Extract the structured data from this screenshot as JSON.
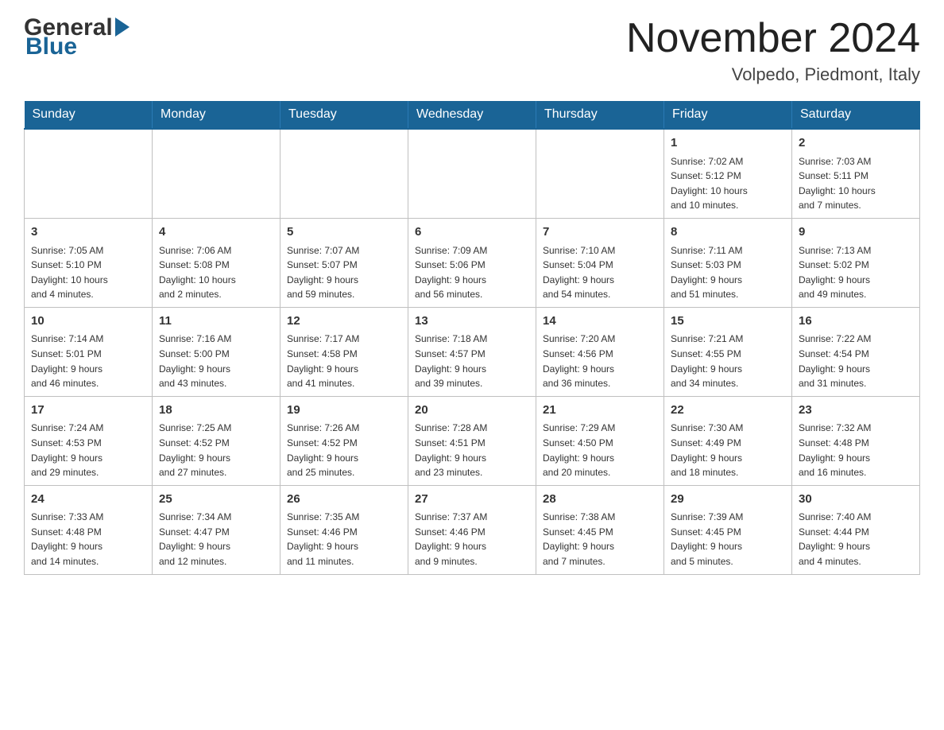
{
  "header": {
    "logo_general": "General",
    "logo_blue": "Blue",
    "month_title": "November 2024",
    "location": "Volpedo, Piedmont, Italy"
  },
  "weekdays": [
    "Sunday",
    "Monday",
    "Tuesday",
    "Wednesday",
    "Thursday",
    "Friday",
    "Saturday"
  ],
  "rows": [
    {
      "cells": [
        {
          "day": "",
          "info": ""
        },
        {
          "day": "",
          "info": ""
        },
        {
          "day": "",
          "info": ""
        },
        {
          "day": "",
          "info": ""
        },
        {
          "day": "",
          "info": ""
        },
        {
          "day": "1",
          "info": "Sunrise: 7:02 AM\nSunset: 5:12 PM\nDaylight: 10 hours\nand 10 minutes."
        },
        {
          "day": "2",
          "info": "Sunrise: 7:03 AM\nSunset: 5:11 PM\nDaylight: 10 hours\nand 7 minutes."
        }
      ]
    },
    {
      "cells": [
        {
          "day": "3",
          "info": "Sunrise: 7:05 AM\nSunset: 5:10 PM\nDaylight: 10 hours\nand 4 minutes."
        },
        {
          "day": "4",
          "info": "Sunrise: 7:06 AM\nSunset: 5:08 PM\nDaylight: 10 hours\nand 2 minutes."
        },
        {
          "day": "5",
          "info": "Sunrise: 7:07 AM\nSunset: 5:07 PM\nDaylight: 9 hours\nand 59 minutes."
        },
        {
          "day": "6",
          "info": "Sunrise: 7:09 AM\nSunset: 5:06 PM\nDaylight: 9 hours\nand 56 minutes."
        },
        {
          "day": "7",
          "info": "Sunrise: 7:10 AM\nSunset: 5:04 PM\nDaylight: 9 hours\nand 54 minutes."
        },
        {
          "day": "8",
          "info": "Sunrise: 7:11 AM\nSunset: 5:03 PM\nDaylight: 9 hours\nand 51 minutes."
        },
        {
          "day": "9",
          "info": "Sunrise: 7:13 AM\nSunset: 5:02 PM\nDaylight: 9 hours\nand 49 minutes."
        }
      ]
    },
    {
      "cells": [
        {
          "day": "10",
          "info": "Sunrise: 7:14 AM\nSunset: 5:01 PM\nDaylight: 9 hours\nand 46 minutes."
        },
        {
          "day": "11",
          "info": "Sunrise: 7:16 AM\nSunset: 5:00 PM\nDaylight: 9 hours\nand 43 minutes."
        },
        {
          "day": "12",
          "info": "Sunrise: 7:17 AM\nSunset: 4:58 PM\nDaylight: 9 hours\nand 41 minutes."
        },
        {
          "day": "13",
          "info": "Sunrise: 7:18 AM\nSunset: 4:57 PM\nDaylight: 9 hours\nand 39 minutes."
        },
        {
          "day": "14",
          "info": "Sunrise: 7:20 AM\nSunset: 4:56 PM\nDaylight: 9 hours\nand 36 minutes."
        },
        {
          "day": "15",
          "info": "Sunrise: 7:21 AM\nSunset: 4:55 PM\nDaylight: 9 hours\nand 34 minutes."
        },
        {
          "day": "16",
          "info": "Sunrise: 7:22 AM\nSunset: 4:54 PM\nDaylight: 9 hours\nand 31 minutes."
        }
      ]
    },
    {
      "cells": [
        {
          "day": "17",
          "info": "Sunrise: 7:24 AM\nSunset: 4:53 PM\nDaylight: 9 hours\nand 29 minutes."
        },
        {
          "day": "18",
          "info": "Sunrise: 7:25 AM\nSunset: 4:52 PM\nDaylight: 9 hours\nand 27 minutes."
        },
        {
          "day": "19",
          "info": "Sunrise: 7:26 AM\nSunset: 4:52 PM\nDaylight: 9 hours\nand 25 minutes."
        },
        {
          "day": "20",
          "info": "Sunrise: 7:28 AM\nSunset: 4:51 PM\nDaylight: 9 hours\nand 23 minutes."
        },
        {
          "day": "21",
          "info": "Sunrise: 7:29 AM\nSunset: 4:50 PM\nDaylight: 9 hours\nand 20 minutes."
        },
        {
          "day": "22",
          "info": "Sunrise: 7:30 AM\nSunset: 4:49 PM\nDaylight: 9 hours\nand 18 minutes."
        },
        {
          "day": "23",
          "info": "Sunrise: 7:32 AM\nSunset: 4:48 PM\nDaylight: 9 hours\nand 16 minutes."
        }
      ]
    },
    {
      "cells": [
        {
          "day": "24",
          "info": "Sunrise: 7:33 AM\nSunset: 4:48 PM\nDaylight: 9 hours\nand 14 minutes."
        },
        {
          "day": "25",
          "info": "Sunrise: 7:34 AM\nSunset: 4:47 PM\nDaylight: 9 hours\nand 12 minutes."
        },
        {
          "day": "26",
          "info": "Sunrise: 7:35 AM\nSunset: 4:46 PM\nDaylight: 9 hours\nand 11 minutes."
        },
        {
          "day": "27",
          "info": "Sunrise: 7:37 AM\nSunset: 4:46 PM\nDaylight: 9 hours\nand 9 minutes."
        },
        {
          "day": "28",
          "info": "Sunrise: 7:38 AM\nSunset: 4:45 PM\nDaylight: 9 hours\nand 7 minutes."
        },
        {
          "day": "29",
          "info": "Sunrise: 7:39 AM\nSunset: 4:45 PM\nDaylight: 9 hours\nand 5 minutes."
        },
        {
          "day": "30",
          "info": "Sunrise: 7:40 AM\nSunset: 4:44 PM\nDaylight: 9 hours\nand 4 minutes."
        }
      ]
    }
  ]
}
